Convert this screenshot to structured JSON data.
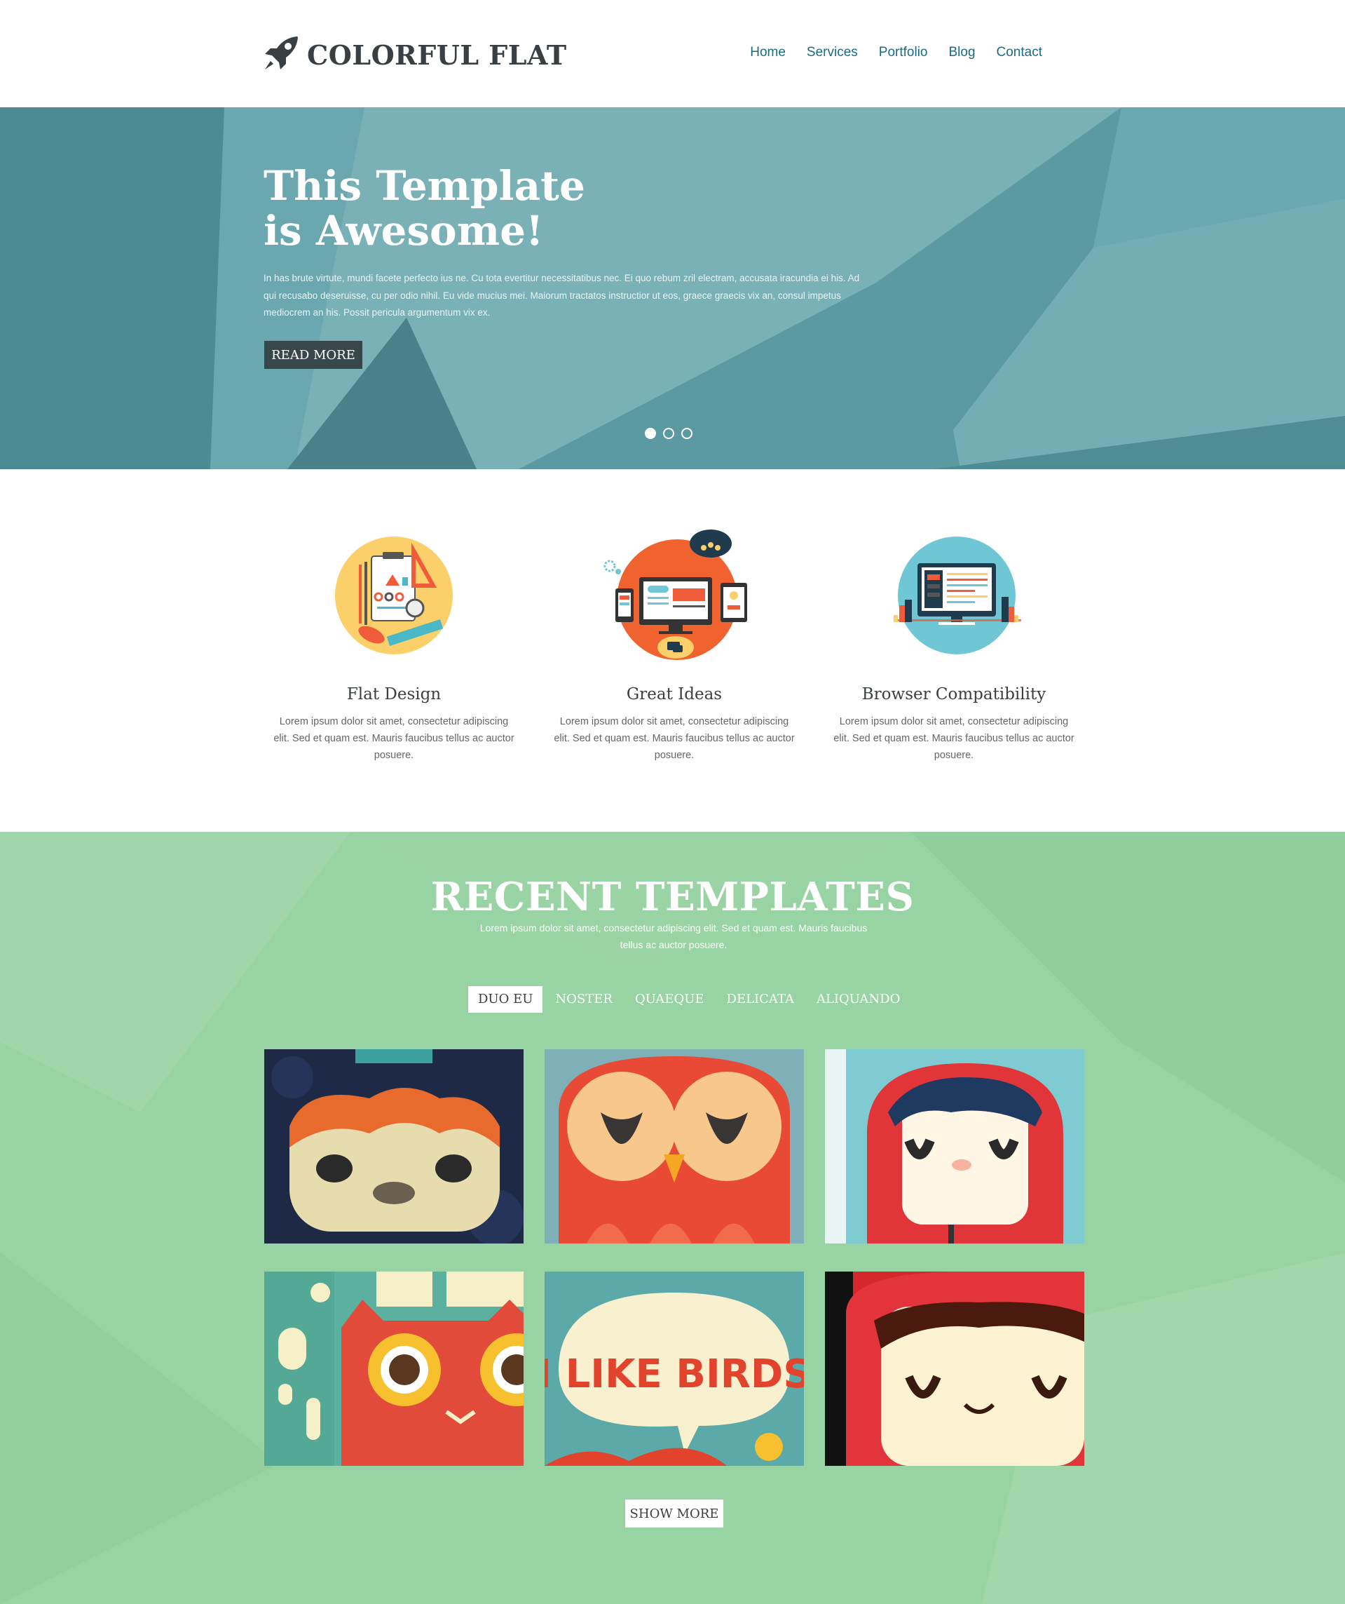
{
  "header": {
    "logo_text": "COLORFUL FLAT",
    "logo_icon": "rocket-icon",
    "nav": [
      "Home",
      "Services",
      "Portfolio",
      "Blog",
      "Contact"
    ]
  },
  "hero": {
    "title": "This Template\nis Awesome!",
    "text": "In has brute virtute, mundi facete perfecto ius ne. Cu tota evertitur necessitatibus nec. Ei quo rebum zril electram, accusata iracundia ei his. Ad qui recusabo deseruisse, cu per odio nihil. Eu vide mucius mei. Maiorum tractatos instructior ut eos, graece graecis vix an, consul impetus mediocrem an his. Possit pericula argumentum vix ex.",
    "button": "READ MORE",
    "slides": 3,
    "active_slide": 1
  },
  "features": [
    {
      "title": "Flat Design",
      "text": "Lorem ipsum dolor sit amet, consectetur adipiscing elit. Sed et quam est. Mauris faucibus tellus ac auctor posuere."
    },
    {
      "title": "Great Ideas",
      "text": "Lorem ipsum dolor sit amet, consectetur adipiscing elit. Sed et quam est. Mauris faucibus tellus ac auctor posuere."
    },
    {
      "title": "Browser  Compatibility",
      "text": "Lorem ipsum dolor sit amet, consectetur adipiscing elit. Sed et quam est. Mauris faucibus tellus ac auctor posuere."
    }
  ],
  "recent": {
    "title": "RECENT TEMPLATES",
    "subtitle": "Lorem ipsum dolor sit amet, consectetur adipiscing elit. Sed et quam est. Mauris faucibus tellus ac auctor posuere.",
    "filters": [
      "DUO EU",
      "NOSTER",
      "QUAEQUE",
      "DELICATA",
      "ALIQUANDO"
    ],
    "active_filter": "DUO EU",
    "thumb_banner": "I LIKE BIRDS",
    "button": "SHOW MORE"
  },
  "colors": {
    "hero_bg": "#5fa0a8",
    "recent_bg": "#98d3a3",
    "nav_link": "#1d6a86",
    "dark": "#38474c"
  }
}
